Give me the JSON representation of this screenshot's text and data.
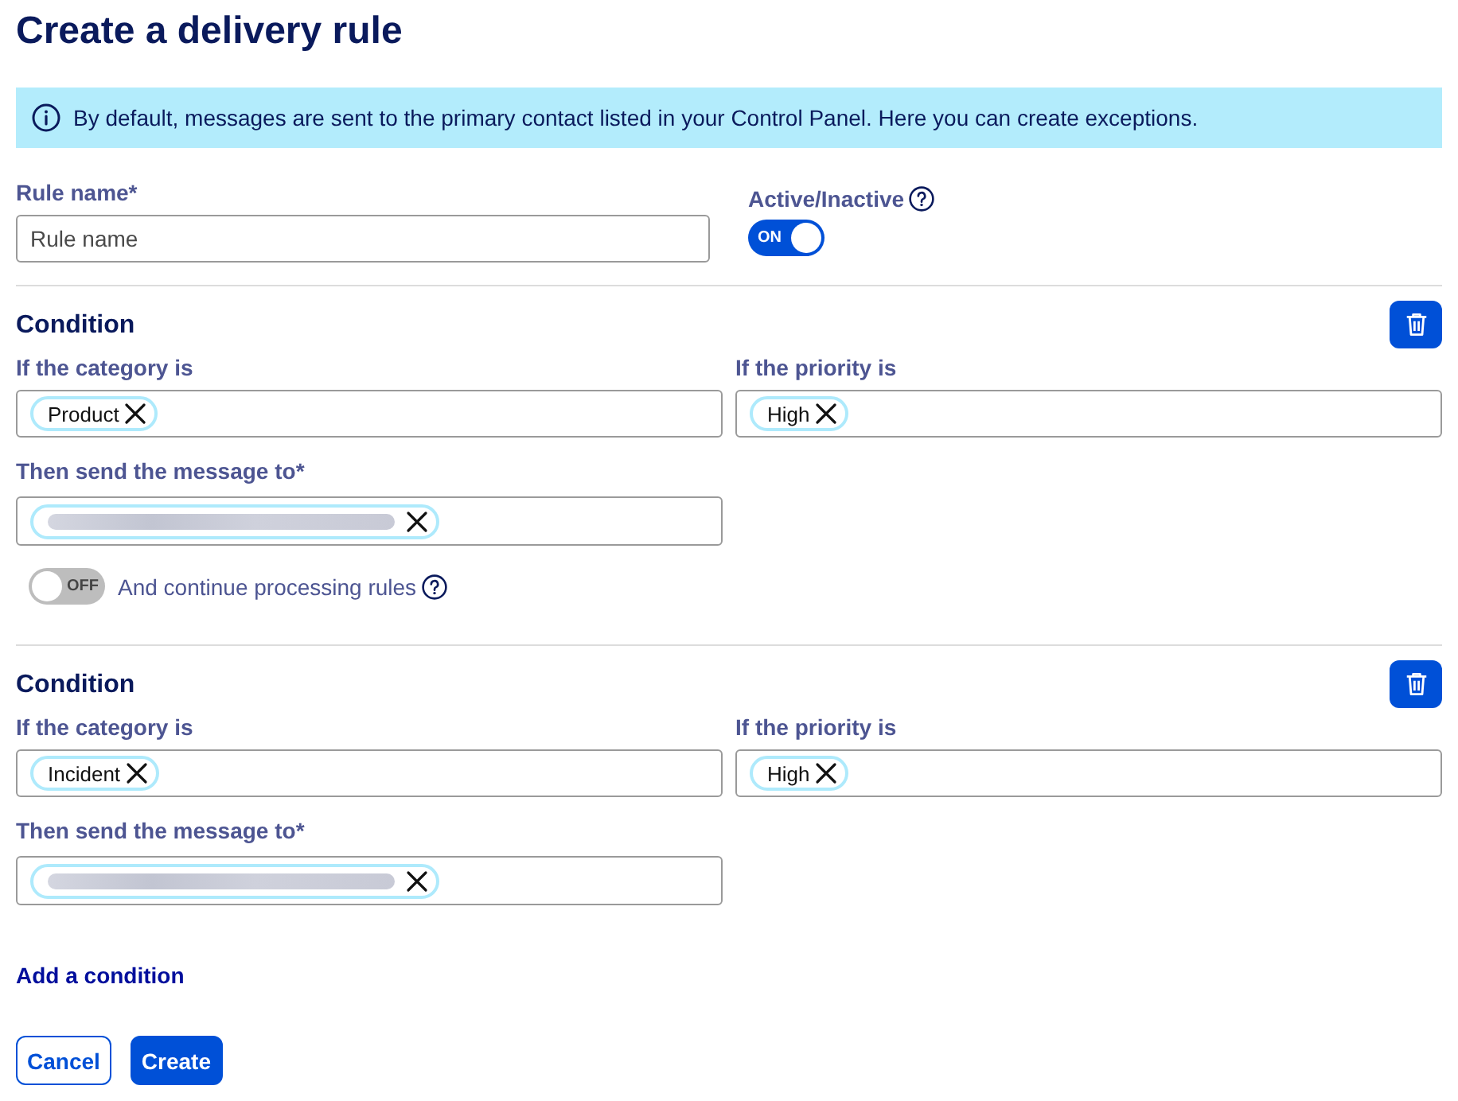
{
  "title": "Create a delivery rule",
  "info_banner": {
    "text": "By default, messages are sent to the primary contact listed in your Control Panel. Here you can create exceptions."
  },
  "rule_name": {
    "label": "Rule name*",
    "placeholder": "Rule name"
  },
  "active": {
    "label": "Active/Inactive",
    "on": true,
    "toggle_text": "ON"
  },
  "conditions": [
    {
      "heading": "Condition",
      "category": {
        "label": "If the category is",
        "chips": [
          {
            "kind": "text",
            "text": "Product"
          }
        ]
      },
      "priority": {
        "label": "If the priority is",
        "chips": [
          {
            "kind": "text",
            "text": "High"
          }
        ]
      },
      "recipient": {
        "label": "Then send the message to*",
        "chips": [
          {
            "kind": "blurred"
          }
        ]
      },
      "continue": {
        "label": "And continue processing rules",
        "on": false,
        "toggle_text": "OFF"
      }
    },
    {
      "heading": "Condition",
      "category": {
        "label": "If the category is",
        "chips": [
          {
            "kind": "text",
            "text": "Incident"
          }
        ]
      },
      "priority": {
        "label": "If the priority is",
        "chips": [
          {
            "kind": "text",
            "text": "High"
          }
        ]
      },
      "recipient": {
        "label": "Then send the message to*",
        "chips": [
          {
            "kind": "blurred"
          }
        ]
      }
    }
  ],
  "add_condition": "Add a condition",
  "buttons": [
    {
      "label": "Cancel",
      "kind": "secondary"
    },
    {
      "label": "Create",
      "kind": "primary"
    }
  ]
}
